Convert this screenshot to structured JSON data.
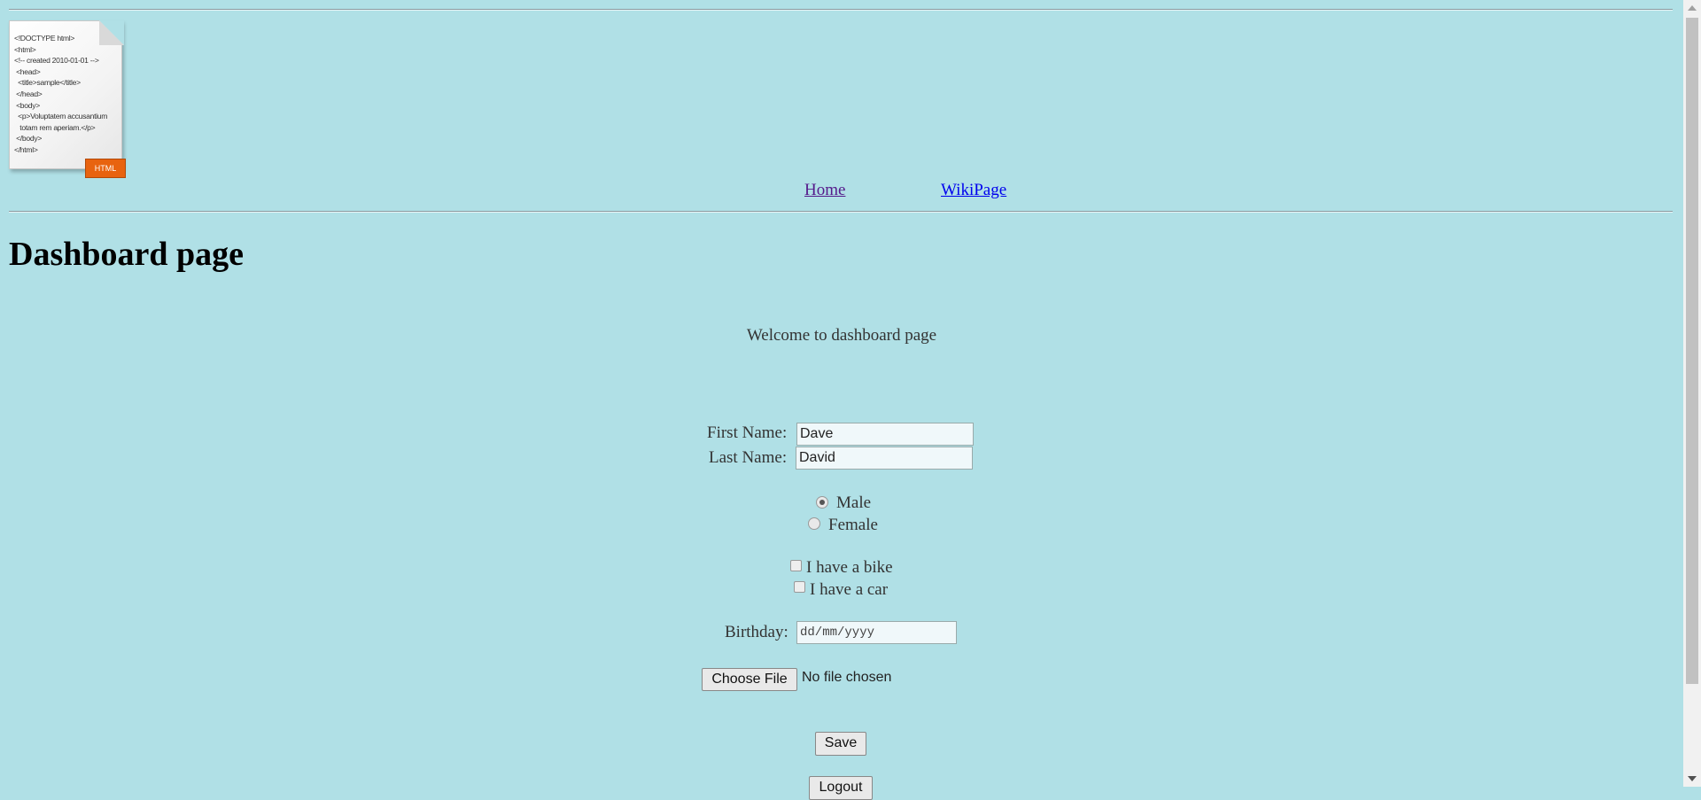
{
  "logo": {
    "code_lines": [
      "<!DOCTYPE html>",
      "<html>",
      "<!-- created 2010-01-01 -->",
      " <head>",
      "  <title>sample</title>",
      " </head>",
      " <body>",
      "  <p>Voluptatem accusantium",
      "   totam rem aperiam.</p>",
      " </body>",
      "</html>"
    ],
    "tag": "HTML"
  },
  "nav": {
    "home": "Home",
    "wiki": "WikiPage"
  },
  "page": {
    "title": "Dashboard page",
    "welcome": "Welcome to dashboard page"
  },
  "form": {
    "first_name_label": "First Name:",
    "first_name_value": "Dave",
    "last_name_label": "Last Name:",
    "last_name_value": "David",
    "gender_options": [
      "Male",
      "Female"
    ],
    "gender_selected": "Male",
    "vehicles": [
      "I have a bike",
      "I have a car"
    ],
    "birthday_label": "Birthday:",
    "birthday_placeholder": "dd/mm/yyyy",
    "file_button": "Choose File",
    "file_status": "No file chosen",
    "save": "Save",
    "logout": "Logout"
  }
}
